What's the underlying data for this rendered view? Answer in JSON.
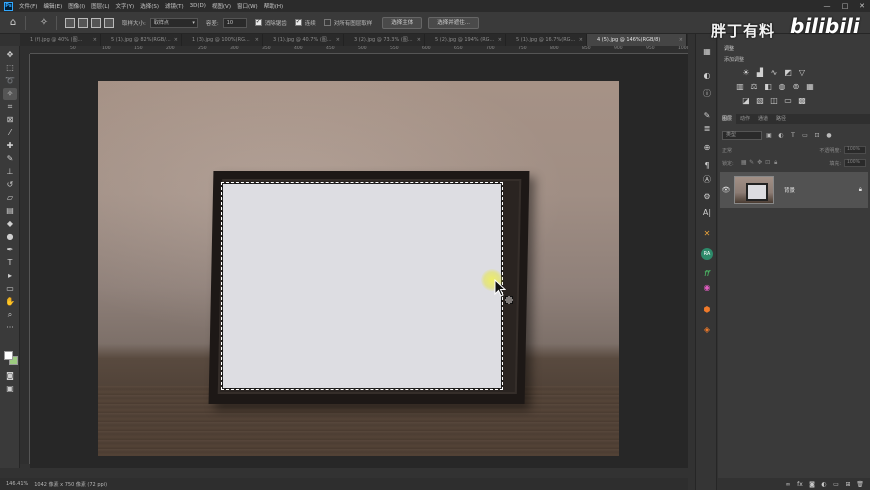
{
  "menu": {
    "logo": "Ps",
    "items": [
      "文件(F)",
      "编辑(E)",
      "图像(I)",
      "图层(L)",
      "文字(Y)",
      "选择(S)",
      "滤镜(T)",
      "3D(D)",
      "视图(V)",
      "窗口(W)",
      "帮助(H)"
    ],
    "window_controls": [
      "—",
      "□",
      "✕"
    ]
  },
  "options": {
    "sample_size_label": "取样大小:",
    "sample_size_value": "取样点",
    "tolerance_label": "容差:",
    "tolerance_value": "10",
    "antialias_label": "消除锯齿",
    "contiguous_label": "连续",
    "sample_all_label": "对所有图层取样",
    "select_subject_button": "选择主体",
    "select_mask_button": "选择并遮住..."
  },
  "tabs": [
    {
      "label": "1 (f).jpg @ 40% (图..."
    },
    {
      "label": "5 (1).jpg @ 82%(RGB/..."
    },
    {
      "label": "1 (3).jpg @ 100%(RG..."
    },
    {
      "label": "3 (1).jpg @ 40.7% (图..."
    },
    {
      "label": "3 (2).jpg @ 73.3% (图..."
    },
    {
      "label": "5 (2).jpg @ 194% (RG..."
    },
    {
      "label": "5 (1).jpg @ 16.7%(RG..."
    },
    {
      "label": "4 (5).jpg @ 146%(RGB/8)",
      "active": true
    }
  ],
  "ruler": {
    "ticks": [
      "50",
      "100",
      "150",
      "200",
      "250",
      "300",
      "350",
      "400",
      "450",
      "500",
      "550",
      "600",
      "650",
      "700",
      "750",
      "800",
      "850",
      "900",
      "950",
      "1000"
    ]
  },
  "status": {
    "zoom": "146.41%",
    "doc_info": "1042 像素 x 750 像素 (72 ppi)"
  },
  "watermark": {
    "author": "胖丁有料",
    "site": "bilibili"
  },
  "adjustments": {
    "panel_title": "调整",
    "subtitle": "添加调整"
  },
  "layers": {
    "tabs": [
      "图层",
      "动作",
      "通道",
      "路径"
    ],
    "filter_placeholder": "类型",
    "blend_mode": "正常",
    "opacity_label": "不透明度:",
    "opacity_value": "100%",
    "lock_label": "锁定:",
    "fill_label": "填充:",
    "fill_value": "100%",
    "items": [
      {
        "name": "背景"
      }
    ]
  },
  "colors": {
    "foreground": "#ffffff",
    "background": "#9ccb7f",
    "accent": "#31a8ff"
  }
}
